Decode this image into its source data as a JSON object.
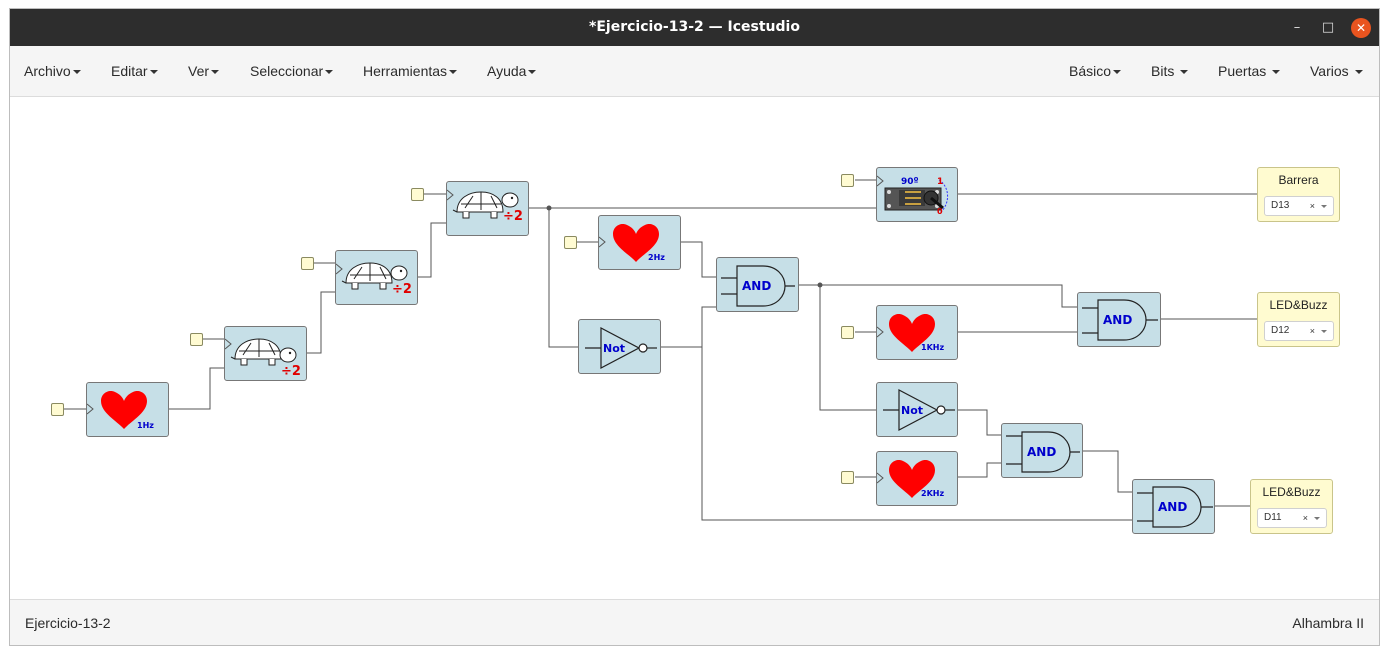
{
  "window": {
    "title": "*Ejercicio-13-2 — Icestudio",
    "minimize_glyph": "–",
    "maximize_glyph": "□",
    "close_glyph": "✕"
  },
  "menubar": {
    "left": [
      "Archivo",
      "Editar",
      "Ver",
      "Seleccionar",
      "Herramientas",
      "Ayuda"
    ],
    "right": [
      "Básico",
      "Bits",
      "Puertas",
      "Varios"
    ]
  },
  "blocks": {
    "heart_1hz": "1Hz",
    "heart_2hz": "2Hz",
    "heart_1khz": "1KHz",
    "heart_2khz": "2KHz",
    "divider_label": "÷2",
    "not_label": "Not",
    "and_label": "AND",
    "servo_angle": "90º",
    "servo_one": "1",
    "servo_zero": "0"
  },
  "outputs": [
    {
      "name": "Barrera",
      "pin": "D13",
      "clear": "×"
    },
    {
      "name": "LED&Buzz",
      "pin": "D12",
      "clear": "×"
    },
    {
      "name": "LED&Buzz",
      "pin": "D11",
      "clear": "×"
    }
  ],
  "statusbar": {
    "project": "Ejercicio-13-2",
    "board": "Alhambra II"
  },
  "colors": {
    "block_bg": "#c6dfe7",
    "heart": "#ff0000",
    "label_blue": "#0000cc",
    "divider_red": "#e00000",
    "output_bg": "#fffbd0",
    "titlebar": "#2d2d2d",
    "close_button": "#e9541f"
  }
}
